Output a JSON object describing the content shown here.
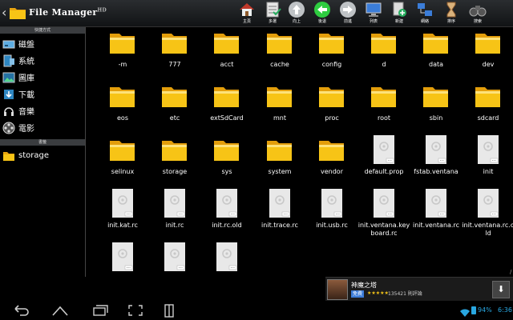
{
  "app": {
    "title": "File Manager",
    "title_sup": "HD"
  },
  "toolbar": [
    {
      "name": "home-button",
      "icon": "house-icon",
      "label": "主頁"
    },
    {
      "name": "multi-select-button",
      "icon": "checklist-icon",
      "label": "多選"
    },
    {
      "name": "up-button",
      "icon": "arrow-up-icon",
      "label": "向上"
    },
    {
      "name": "back-button",
      "icon": "arrow-left-icon",
      "label": "後退"
    },
    {
      "name": "forward-button",
      "icon": "arrow-right-icon",
      "label": "前進"
    },
    {
      "name": "list-view-button",
      "icon": "monitor-icon",
      "label": "列表"
    },
    {
      "name": "new-folder-button",
      "icon": "new-folder-icon",
      "label": "新建"
    },
    {
      "name": "network-button",
      "icon": "network-icon",
      "label": "網絡"
    },
    {
      "name": "sort-button",
      "icon": "hourglass-icon",
      "label": "排序"
    },
    {
      "name": "search-button",
      "icon": "binoculars-icon",
      "label": "搜索"
    }
  ],
  "sidebar": {
    "shortcuts_header": "快捷方式",
    "shortcuts": [
      {
        "name": "sidebar-item-disk",
        "icon": "disk-icon",
        "label": "磁盤"
      },
      {
        "name": "sidebar-item-system",
        "icon": "system-icon",
        "label": "系統"
      },
      {
        "name": "sidebar-item-pictures",
        "icon": "picture-icon",
        "label": "圖庫"
      },
      {
        "name": "sidebar-item-downloads",
        "icon": "download-icon",
        "label": "下載"
      },
      {
        "name": "sidebar-item-music",
        "icon": "music-icon",
        "label": "音樂"
      },
      {
        "name": "sidebar-item-video",
        "icon": "film-icon",
        "label": "電影"
      }
    ],
    "storage_header": "書籤",
    "storage": [
      {
        "name": "sidebar-item-storage",
        "icon": "folder-icon",
        "label": "storage"
      }
    ]
  },
  "files": [
    {
      "label": "-m",
      "type": "folder"
    },
    {
      "label": "777",
      "type": "folder"
    },
    {
      "label": "acct",
      "type": "folder"
    },
    {
      "label": "cache",
      "type": "folder"
    },
    {
      "label": "config",
      "type": "folder"
    },
    {
      "label": "d",
      "type": "folder"
    },
    {
      "label": "data",
      "type": "folder"
    },
    {
      "label": "dev",
      "type": "folder"
    },
    {
      "label": "eos",
      "type": "folder"
    },
    {
      "label": "etc",
      "type": "folder"
    },
    {
      "label": "extSdCard",
      "type": "folder"
    },
    {
      "label": "mnt",
      "type": "folder"
    },
    {
      "label": "proc",
      "type": "folder"
    },
    {
      "label": "root",
      "type": "folder"
    },
    {
      "label": "sbin",
      "type": "folder"
    },
    {
      "label": "sdcard",
      "type": "folder"
    },
    {
      "label": "selinux",
      "type": "folder"
    },
    {
      "label": "storage",
      "type": "folder"
    },
    {
      "label": "sys",
      "type": "folder"
    },
    {
      "label": "system",
      "type": "folder"
    },
    {
      "label": "vendor",
      "type": "folder"
    },
    {
      "label": "default.prop",
      "type": "file"
    },
    {
      "label": "fstab.ventana",
      "type": "file"
    },
    {
      "label": "init",
      "type": "file"
    },
    {
      "label": "init.kat.rc",
      "type": "file"
    },
    {
      "label": "init.rc",
      "type": "file"
    },
    {
      "label": "init.rc.old",
      "type": "file"
    },
    {
      "label": "init.trace.rc",
      "type": "file"
    },
    {
      "label": "init.usb.rc",
      "type": "file"
    },
    {
      "label": "init.ventana.keyboard.rc",
      "type": "file"
    },
    {
      "label": "init.ventana.rc",
      "type": "file"
    },
    {
      "label": "init.ventana.rc.old",
      "type": "file"
    },
    {
      "label": "",
      "type": "file"
    },
    {
      "label": "",
      "type": "file"
    },
    {
      "label": "",
      "type": "file"
    }
  ],
  "ad": {
    "title": "神魔之塔",
    "free_badge": "免費",
    "stars": "★★★★★",
    "reviews": "135421 則評論",
    "download_icon": "download-arrow-icon",
    "corner_mark": "/"
  },
  "status": {
    "battery": "94%",
    "time": "6:36"
  },
  "colors": {
    "accent": "#29a7e1",
    "folder": "#f7c416"
  }
}
